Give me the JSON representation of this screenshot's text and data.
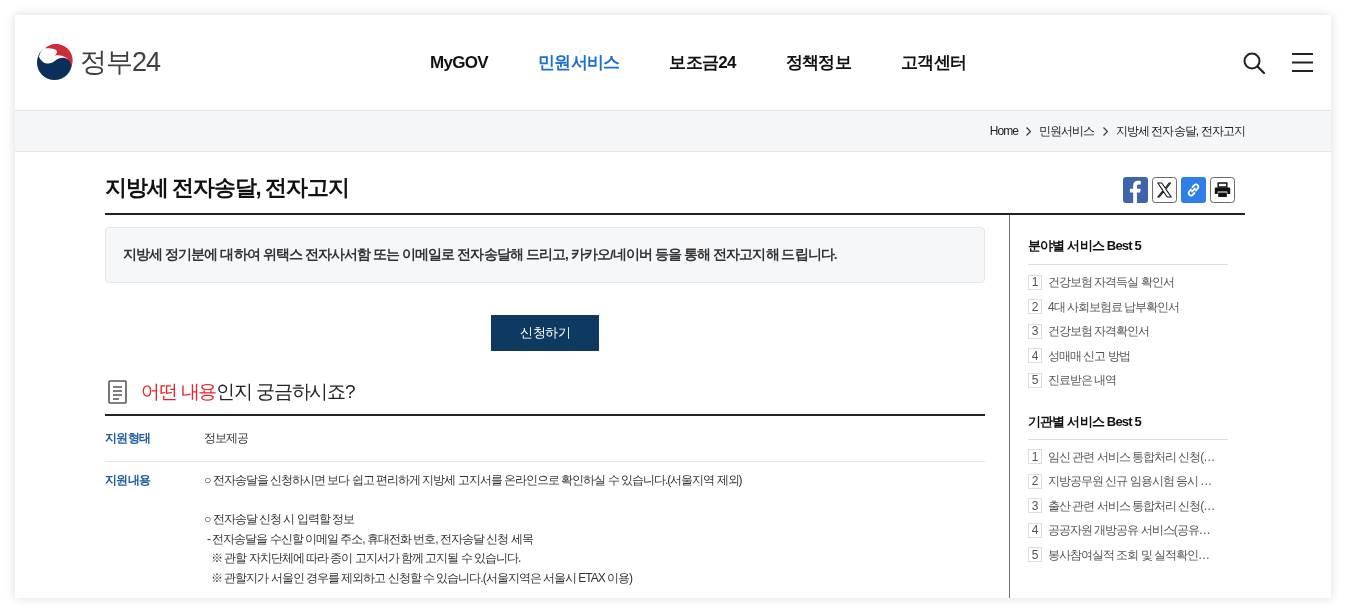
{
  "header": {
    "logo_text": "정부24",
    "nav": [
      {
        "label": "MyGOV",
        "selected": false
      },
      {
        "label": "민원서비스",
        "selected": true
      },
      {
        "label": "보조금24",
        "selected": false
      },
      {
        "label": "정책정보",
        "selected": false
      },
      {
        "label": "고객센터",
        "selected": false
      }
    ]
  },
  "breadcrumb": [
    "Home",
    "민원서비스",
    "지방세 전자송달, 전자고지"
  ],
  "page": {
    "title": "지방세 전자송달, 전자고지",
    "summary": "지방세 정기분에 대하여 위택스 전자사서함 또는 이메일로 전자송달해 드리고, 카카오/네이버 등을 통해 전자고지해 드립니다.",
    "apply_button": "신청하기"
  },
  "section": {
    "highlight": "어떤 내용",
    "rest": "인지 궁금하시죠?"
  },
  "details": [
    {
      "label": "지원형태",
      "blocks": [
        [
          {
            "kind": "plain",
            "text": "정보제공"
          }
        ]
      ]
    },
    {
      "label": "지원내용",
      "blocks": [
        [
          {
            "kind": "bullet",
            "text": "○ 전자송달을 신청하시면 보다 쉽고 편리하게 지방세 고지서를 온라인으로 확인하실 수 있습니다.(서울지역 제외)"
          }
        ],
        [
          {
            "kind": "bullet",
            "text": "○ 전자송달 신청 시 입력할 정보"
          },
          {
            "kind": "dash",
            "text": "- 전자송달을 수신할 이메일 주소, 휴대전화 번호, 전자송달 신청 세목"
          },
          {
            "kind": "note",
            "text": "※ 관할 자치단체에 따라 종이 고지서가 함께 고지될 수 있습니다."
          },
          {
            "kind": "note",
            "text": "※ 관할지가 서울인 경우를 제외하고 신청할 수 있습니다.(서울지역은 서울시 ETAX 이용)"
          }
        ]
      ]
    }
  ],
  "sidebar": {
    "sections": [
      {
        "title": "분야별 서비스 Best 5",
        "items": [
          {
            "rank": "1",
            "label": "건강보험 자격득실 확인서"
          },
          {
            "rank": "2",
            "label": "4대 사회보험료 납부확인서"
          },
          {
            "rank": "3",
            "label": "건강보험 자격확인서"
          },
          {
            "rank": "4",
            "label": "성매매 신고 방법"
          },
          {
            "rank": "5",
            "label": "진료받은 내역"
          }
        ]
      },
      {
        "title": "기관별 서비스 Best 5",
        "items": [
          {
            "rank": "1",
            "label": "임신 관련 서비스 통합처리 신청(…"
          },
          {
            "rank": "2",
            "label": "지방공무원 신규 임용시험 응시 …"
          },
          {
            "rank": "3",
            "label": "출산 관련 서비스 통합처리 신청(…"
          },
          {
            "rank": "4",
            "label": "공공자원 개방공유 서비스(공유…"
          },
          {
            "rank": "5",
            "label": "봉사참여실적 조회 및 실적확인…"
          }
        ]
      }
    ]
  }
}
